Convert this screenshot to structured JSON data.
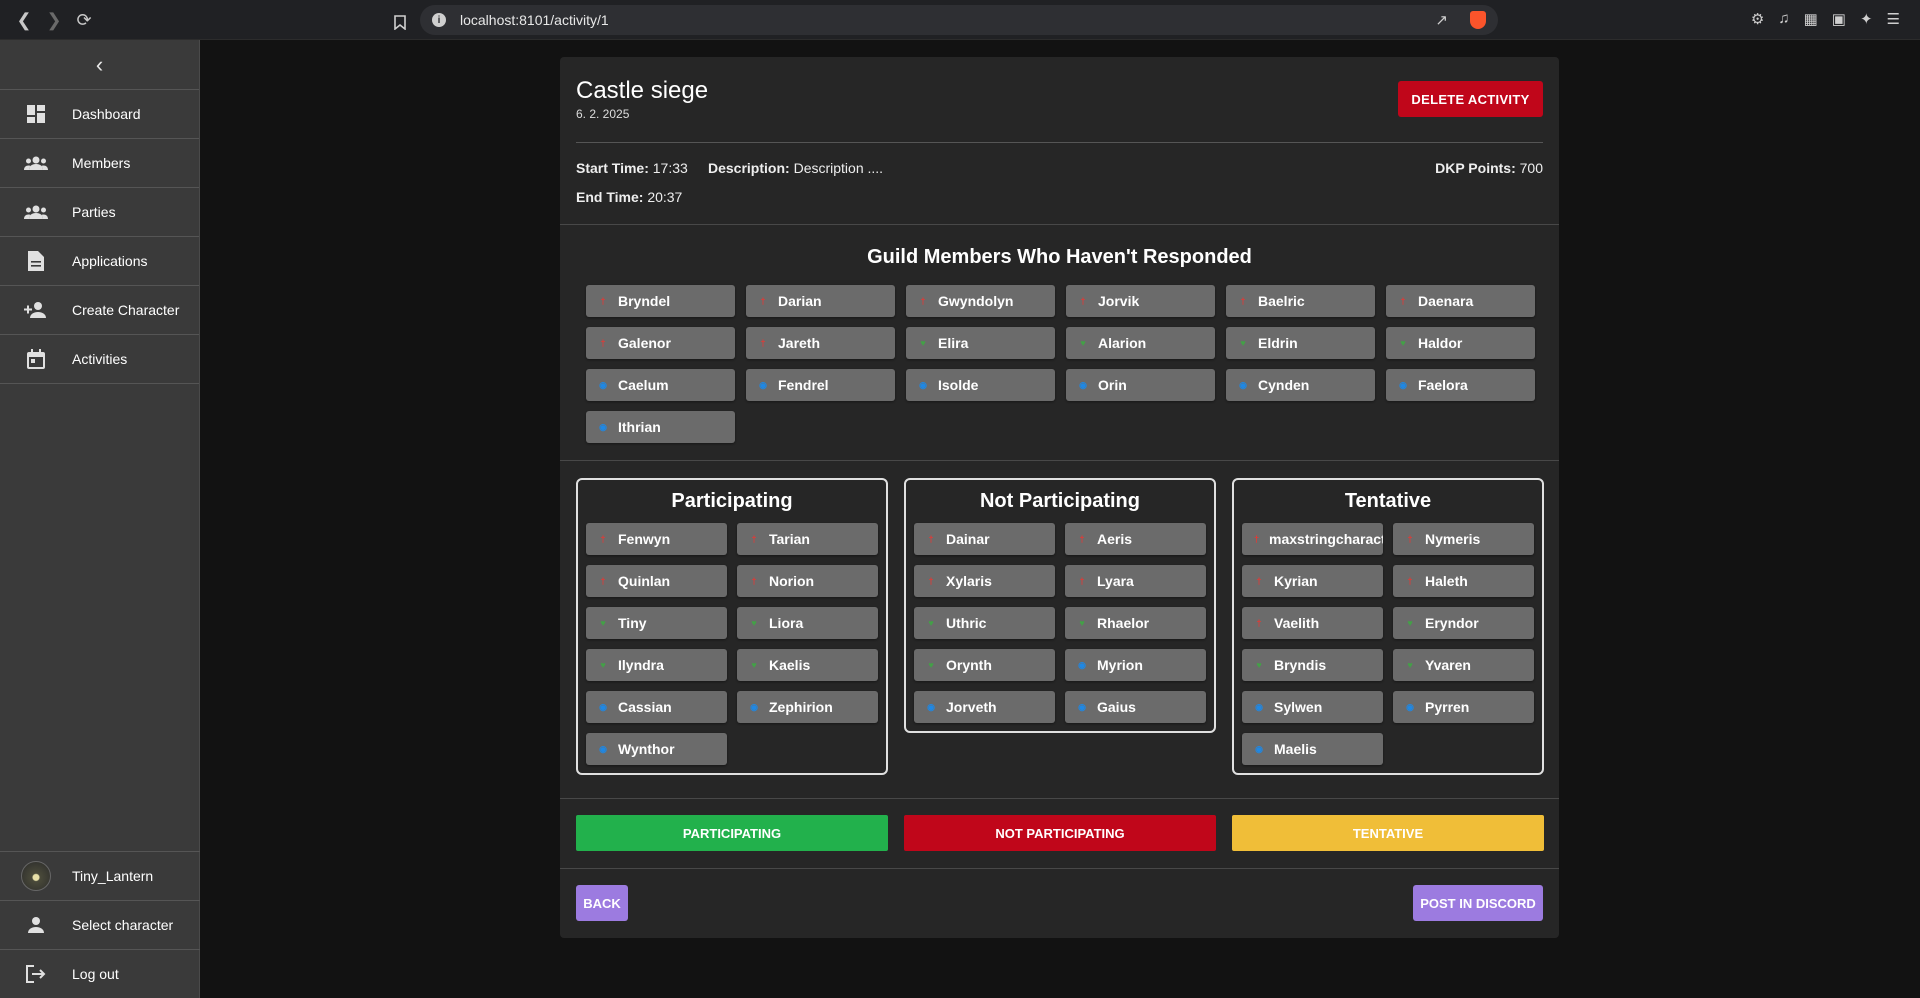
{
  "browser": {
    "url": "localhost:8101/activity/1"
  },
  "sidebar": {
    "items": [
      {
        "label": "Dashboard",
        "icon": "dashboard-icon"
      },
      {
        "label": "Members",
        "icon": "group-icon"
      },
      {
        "label": "Parties",
        "icon": "group-icon"
      },
      {
        "label": "Applications",
        "icon": "document-icon"
      },
      {
        "label": "Create Character",
        "icon": "person-add-icon"
      },
      {
        "label": "Activities",
        "icon": "calendar-icon"
      }
    ],
    "user": "Tiny_Lantern",
    "select_character": "Select character",
    "logout": "Log out"
  },
  "activity": {
    "title": "Castle siege",
    "date": "6. 2. 2025",
    "delete_label": "DELETE ACTIVITY",
    "start_key": "Start Time:",
    "start": "17:33",
    "end_key": "End Time:",
    "end": "20:37",
    "desc_key": "Description:",
    "description": "Description ....",
    "dkp_key": "DKP Points:",
    "dkp": "700"
  },
  "not_responded": {
    "title": "Guild Members Who Haven't Responded",
    "members": [
      {
        "name": "Bryndel",
        "role": "red"
      },
      {
        "name": "Darian",
        "role": "red"
      },
      {
        "name": "Gwyndolyn",
        "role": "red"
      },
      {
        "name": "Jorvik",
        "role": "red"
      },
      {
        "name": "Baelric",
        "role": "red"
      },
      {
        "name": "Daenara",
        "role": "red"
      },
      {
        "name": "Galenor",
        "role": "red"
      },
      {
        "name": "Jareth",
        "role": "red"
      },
      {
        "name": "Elira",
        "role": "green"
      },
      {
        "name": "Alarion",
        "role": "green"
      },
      {
        "name": "Eldrin",
        "role": "green"
      },
      {
        "name": "Haldor",
        "role": "green"
      },
      {
        "name": "Caelum",
        "role": "blue"
      },
      {
        "name": "Fendrel",
        "role": "blue"
      },
      {
        "name": "Isolde",
        "role": "blue"
      },
      {
        "name": "Orin",
        "role": "blue"
      },
      {
        "name": "Cynden",
        "role": "blue"
      },
      {
        "name": "Faelora",
        "role": "blue"
      },
      {
        "name": "Ithrian",
        "role": "blue"
      }
    ]
  },
  "columns": [
    {
      "title": "Participating",
      "members": [
        {
          "name": "Fenwyn",
          "role": "red"
        },
        {
          "name": "Tarian",
          "role": "red"
        },
        {
          "name": "Quinlan",
          "role": "red"
        },
        {
          "name": "Norion",
          "role": "red"
        },
        {
          "name": "Tiny",
          "role": "green"
        },
        {
          "name": "Liora",
          "role": "green"
        },
        {
          "name": "Ilyndra",
          "role": "green"
        },
        {
          "name": "Kaelis",
          "role": "green"
        },
        {
          "name": "Cassian",
          "role": "blue"
        },
        {
          "name": "Zephirion",
          "role": "blue"
        },
        {
          "name": "Wynthor",
          "role": "blue"
        }
      ]
    },
    {
      "title": "Not Participating",
      "members": [
        {
          "name": "Dainar",
          "role": "red"
        },
        {
          "name": "Aeris",
          "role": "red"
        },
        {
          "name": "Xylaris",
          "role": "red"
        },
        {
          "name": "Lyara",
          "role": "red"
        },
        {
          "name": "Uthric",
          "role": "green"
        },
        {
          "name": "Rhaelor",
          "role": "green"
        },
        {
          "name": "Orynth",
          "role": "green"
        },
        {
          "name": "Myrion",
          "role": "blue"
        },
        {
          "name": "Jorveth",
          "role": "blue"
        },
        {
          "name": "Gaius",
          "role": "blue"
        }
      ]
    },
    {
      "title": "Tentative",
      "members": [
        {
          "name": "maxstringcharact",
          "role": "red"
        },
        {
          "name": "Nymeris",
          "role": "red"
        },
        {
          "name": "Kyrian",
          "role": "red"
        },
        {
          "name": "Haleth",
          "role": "red"
        },
        {
          "name": "Vaelith",
          "role": "red"
        },
        {
          "name": "Eryndor",
          "role": "green"
        },
        {
          "name": "Bryndis",
          "role": "green"
        },
        {
          "name": "Yvaren",
          "role": "green"
        },
        {
          "name": "Sylwen",
          "role": "blue"
        },
        {
          "name": "Pyrren",
          "role": "blue"
        },
        {
          "name": "Maelis",
          "role": "blue"
        }
      ]
    }
  ],
  "actions": {
    "participating": "PARTICIPATING",
    "not_participating": "NOT PARTICIPATING",
    "tentative": "TENTATIVE",
    "back": "BACK",
    "post_discord": "POST IN DISCORD"
  },
  "colors": {
    "participating": "#22b14c",
    "not_participating": "#c0061a",
    "tentative": "#f0be38",
    "purple": "#9c7be0",
    "role_icon_glyphs": {
      "red": "sword-icon",
      "green": "heart-icon",
      "blue": "shield-icon"
    }
  }
}
